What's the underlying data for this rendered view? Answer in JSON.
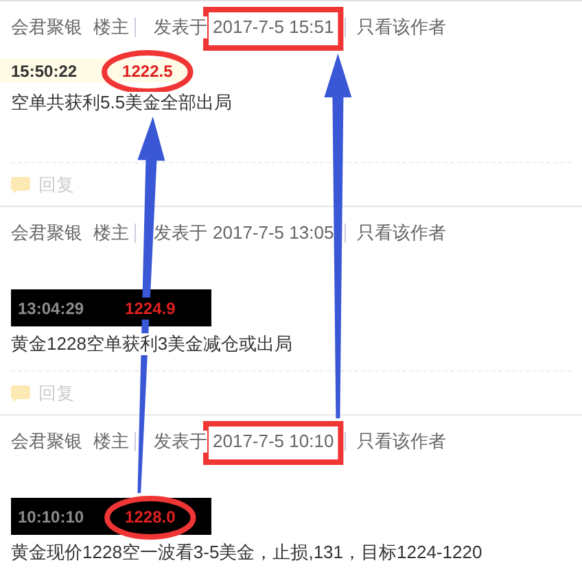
{
  "posts": [
    {
      "author": "会君聚银",
      "role": "楼主",
      "posted_label": "发表于",
      "posted": "2017-7-5 15:51",
      "author_only": "只看该作者",
      "date_boxed": true,
      "quote": {
        "kind": "light",
        "time": "15:50:22",
        "price": "1222.5",
        "circled": true
      },
      "text": "空单共获利5.5美金全部出局",
      "reply": "回复"
    },
    {
      "author": "会君聚银",
      "role": "楼主",
      "posted_label": "发表于",
      "posted": "2017-7-5 13:05",
      "author_only": "只看该作者",
      "date_boxed": false,
      "quote": {
        "kind": "dark",
        "time": "13:04:29",
        "price": "1224.9",
        "circled": false
      },
      "text": "黄金1228空单获利3美金减仓或出局",
      "reply": "回复"
    },
    {
      "author": "会君聚银",
      "role": "楼主",
      "posted_label": "发表于",
      "posted": "2017-7-5 10:10",
      "author_only": "只看该作者",
      "date_boxed": true,
      "quote": {
        "kind": "dark",
        "time": "10:10:10",
        "price": "1228.0",
        "circled": true
      },
      "text": "黄金现价1228空一波看3-5美金，止损,131，目标1224-1220"
    }
  ],
  "annotations": [
    {
      "kind": "arrow"
    },
    {
      "kind": "arrow"
    }
  ]
}
